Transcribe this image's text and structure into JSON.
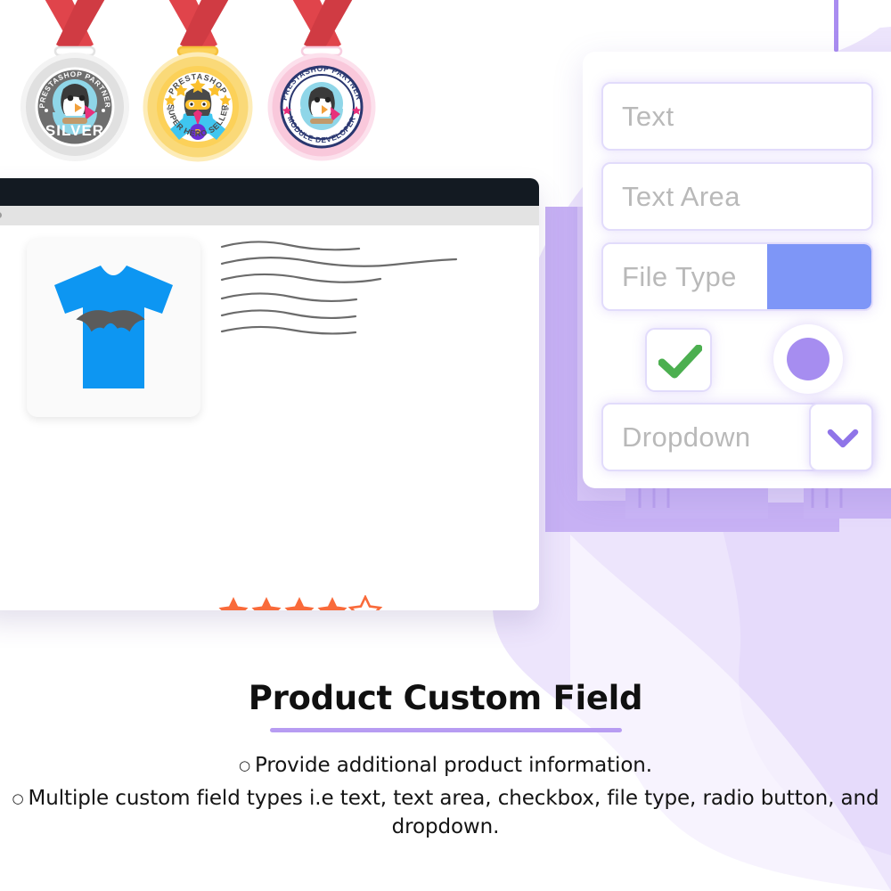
{
  "badges": [
    {
      "name": "silver-partner-medal",
      "ring_color": "#CFCFCF",
      "inner_color": "#6E6E6E",
      "arc_top": "PRESTASHOP PARTNER",
      "arc_bottom": "SILVER",
      "ribbon_color": "#E0444B"
    },
    {
      "name": "super-hero-seller-medal",
      "ring_color": "#FCD159",
      "inner_color": "#FFFFFF",
      "arc_top": "PRESTASHOP",
      "arc_bottom": "SUPER HERO SELLER",
      "ribbon_color": "#E0444B"
    },
    {
      "name": "module-developer-medal",
      "ring_color": "#F9C8DB",
      "inner_color": "#FFFFFF",
      "arc_top": "PRESTASHOP PARTNER",
      "arc_bottom": "MODULE DEVELOPER",
      "ribbon_color": "#E0444B"
    }
  ],
  "browser": {
    "titlebar_color": "#131A22",
    "toolbar_color": "#E3E3E3",
    "product_image": "tshirt-with-bat-logo",
    "tshirt_color": "#0D96F2",
    "bat_color": "#5B5B5B",
    "rating": {
      "filled": 4,
      "total": 5,
      "star_color": "#F96A3A"
    },
    "buy_button": {
      "color": "#4A72F0",
      "label": ""
    },
    "description_card": {
      "columns": 2,
      "lines_per_column": 6
    }
  },
  "form_panel": {
    "fields": [
      {
        "type": "text",
        "placeholder": "Text"
      },
      {
        "type": "textarea",
        "placeholder": "Text Area"
      },
      {
        "type": "file",
        "placeholder": "File Type",
        "browse_color": "#7E96F7"
      },
      {
        "type": "checkbox",
        "checked": true,
        "check_color": "#4CAF50"
      },
      {
        "type": "radio",
        "selected": true,
        "dot_color": "#A68DF0"
      },
      {
        "type": "dropdown",
        "placeholder": "Dropdown",
        "chevron": "chevron-down-icon"
      }
    ],
    "border_color": "#E2DCFB",
    "panel_background": "#FFFFFF"
  },
  "footer": {
    "title": "Product Custom Field",
    "divider_color": "#B79CF2",
    "bullets": [
      "Provide additional product information.",
      "Multiple custom field types i.e text, text area, checkbox, file type, radio button, and dropdown."
    ],
    "bullet_marker": "○"
  },
  "theme": {
    "background": "#FFFFFF",
    "blob_color": "#EAE1FB",
    "accent_purple": "#A98CF0",
    "deco_purple": "#BFA8F2"
  }
}
